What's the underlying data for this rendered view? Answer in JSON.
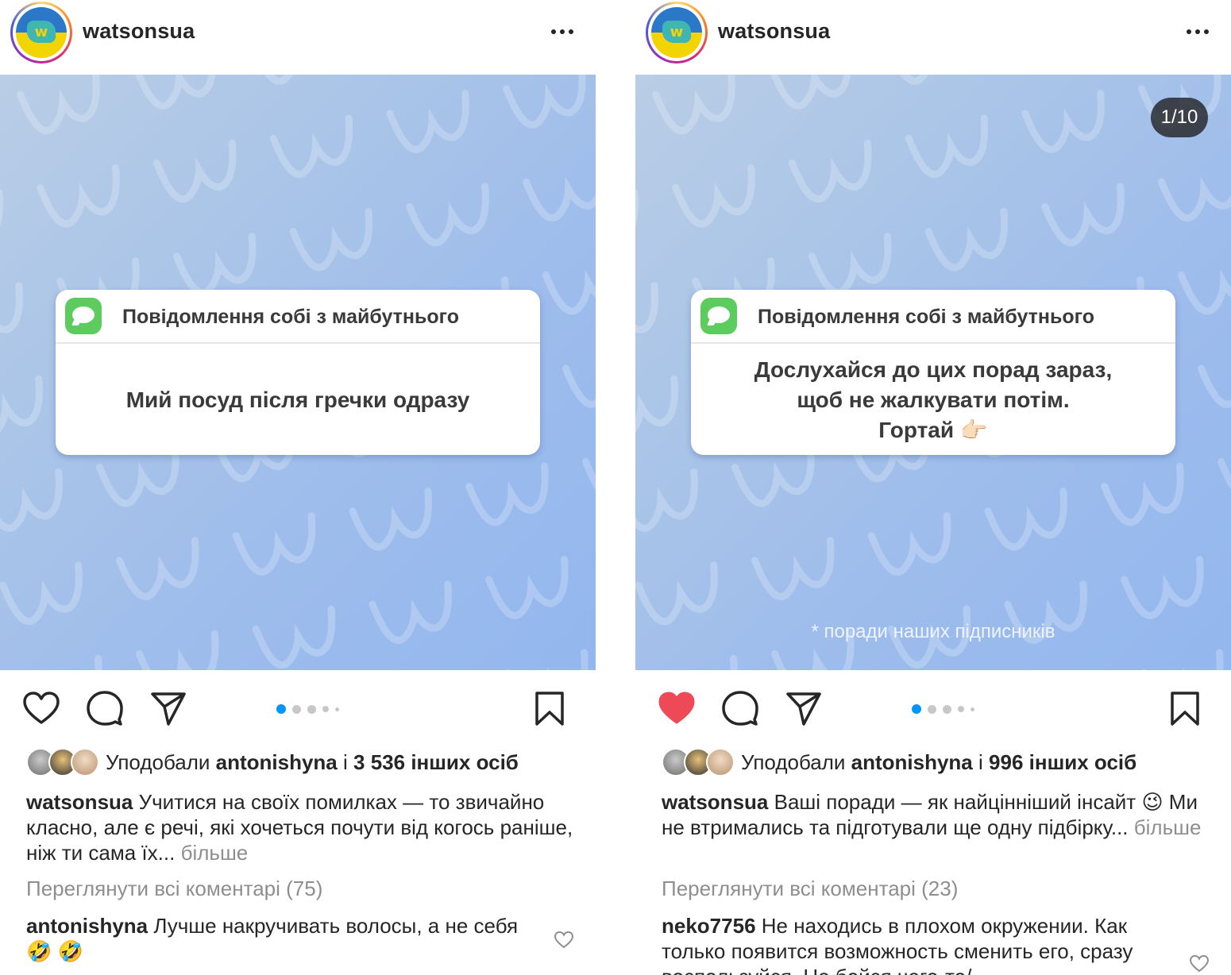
{
  "posts": [
    {
      "username": "watsonsua",
      "card_title": "Повідомлення собі з майбутнього",
      "card_body_lines": [
        "Мий посуд після гречки одразу"
      ],
      "slide_counter": "",
      "footnote": "",
      "liked": false,
      "likes_prefix": "Уподобали",
      "likes_user": "antonishyna",
      "likes_conj": "і",
      "likes_count_text": "3 536 інших осіб",
      "caption_user": "watsonsua",
      "caption_text": "Учитися на своїх помилках — то звичайно класно, але є речі, які хочеться почути від когось раніше, ніж ти сама їх...",
      "caption_more": "більше",
      "view_comments": "Переглянути всі коментарі (75)",
      "comment_user": "antonishyna",
      "comment_text": "Лучше накручивать волосы, а не себя",
      "comment_emoji": "🤣 🤣"
    },
    {
      "username": "watsonsua",
      "card_title": "Повідомлення собі з майбутнього",
      "card_body_lines": [
        "Дослухайся до цих порад зараз,",
        "щоб не жалкувати потім.",
        "Гортай 👉🏻"
      ],
      "slide_counter": "1/10",
      "footnote": "* поради наших підписників",
      "liked": true,
      "likes_prefix": "Уподобали",
      "likes_user": "antonishyna",
      "likes_conj": "і",
      "likes_count_text": "996 інших осіб",
      "caption_user": "watsonsua",
      "caption_text_1": "Ваші поради — як найцінніший інсайт",
      "caption_emoji": "😉",
      "caption_text_2": "Ми не втримались та підготували ще одну підбірку...",
      "caption_more": "більше",
      "view_comments": "Переглянути всі коментарі (23)",
      "comment_user": "neko7756",
      "comment_text": "Не находись в плохом окружении. Как только появится возможность сменить его, сразу воспользуйся. Не бойся чего-то/"
    }
  ],
  "icons": {
    "like": "heart-icon",
    "comment": "comment-bubble-icon",
    "share": "paper-plane-icon",
    "save": "bookmark-icon",
    "more": "more-dots-icon"
  },
  "colors": {
    "like_active": "#ed4956",
    "carousel_active_dot": "#0095f6",
    "muted_text": "#8e8e8e"
  },
  "carousel": {
    "total_dots": 5,
    "active_index": 0
  }
}
